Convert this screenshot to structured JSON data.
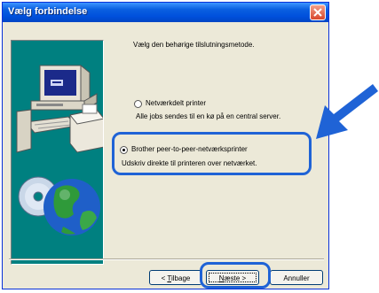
{
  "window": {
    "title": "Vælg forbindelse",
    "close_icon": "close-icon"
  },
  "instruction": "Vælg den behørige tilslutningsmetode.",
  "options": [
    {
      "label": "Netværkdelt printer",
      "description": "Alle jobs sendes til en kø på en central server.",
      "selected": false
    },
    {
      "label": "Brother peer-to-peer-netværksprinter",
      "description": "Udskriv direkte til printeren over netværket.",
      "selected": true
    }
  ],
  "buttons": {
    "back": {
      "prefix": "< ",
      "mnemonic": "T",
      "rest": "ilbage"
    },
    "next": {
      "mnemonic": "N",
      "rest": "æste >"
    },
    "cancel": "Annuller"
  },
  "colors": {
    "highlight": "#1f63d6",
    "arrow": "#1f63d6",
    "art_background": "#008080"
  }
}
